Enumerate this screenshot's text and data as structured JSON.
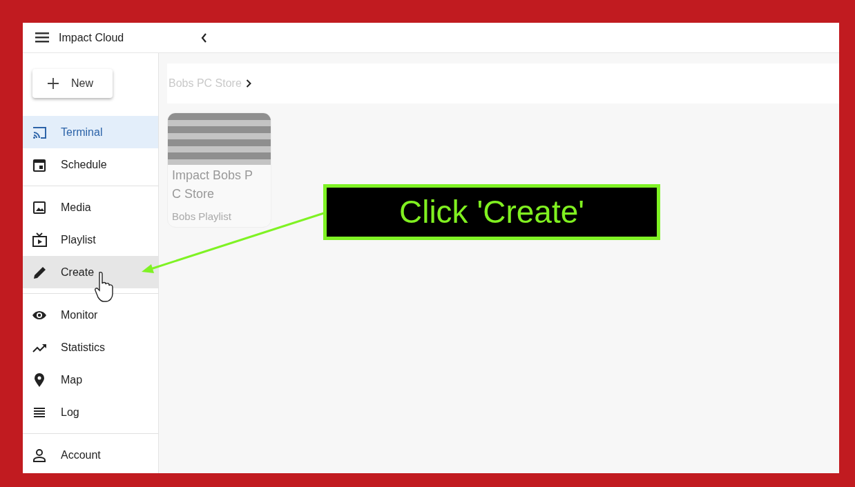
{
  "app": {
    "title": "Impact Cloud"
  },
  "new_button": {
    "label": "New"
  },
  "sidebar": {
    "sections": [
      {
        "items": [
          {
            "kind": "cast",
            "label": "Terminal",
            "selected": true,
            "hovered": false
          },
          {
            "kind": "calendar",
            "label": "Schedule",
            "selected": false,
            "hovered": false
          }
        ]
      },
      {
        "items": [
          {
            "kind": "image",
            "label": "Media",
            "selected": false,
            "hovered": false
          },
          {
            "kind": "tv",
            "label": "Playlist",
            "selected": false,
            "hovered": false
          },
          {
            "kind": "pencil",
            "label": "Create",
            "selected": false,
            "hovered": true
          }
        ]
      },
      {
        "items": [
          {
            "kind": "eye",
            "label": "Monitor",
            "selected": false,
            "hovered": false
          },
          {
            "kind": "trend",
            "label": "Statistics",
            "selected": false,
            "hovered": false
          },
          {
            "kind": "pin",
            "label": "Map",
            "selected": false,
            "hovered": false
          },
          {
            "kind": "lines",
            "label": "Log",
            "selected": false,
            "hovered": false
          }
        ]
      },
      {
        "items": [
          {
            "kind": "person",
            "label": "Account",
            "selected": false,
            "hovered": false
          }
        ]
      }
    ]
  },
  "breadcrumb": [
    {
      "label": "Bobs PC Store"
    }
  ],
  "cards": [
    {
      "title": "Impact Bobs PC Store",
      "subtitle": "Bobs Playlist"
    }
  ],
  "annotation": {
    "text": "Click 'Create'"
  }
}
